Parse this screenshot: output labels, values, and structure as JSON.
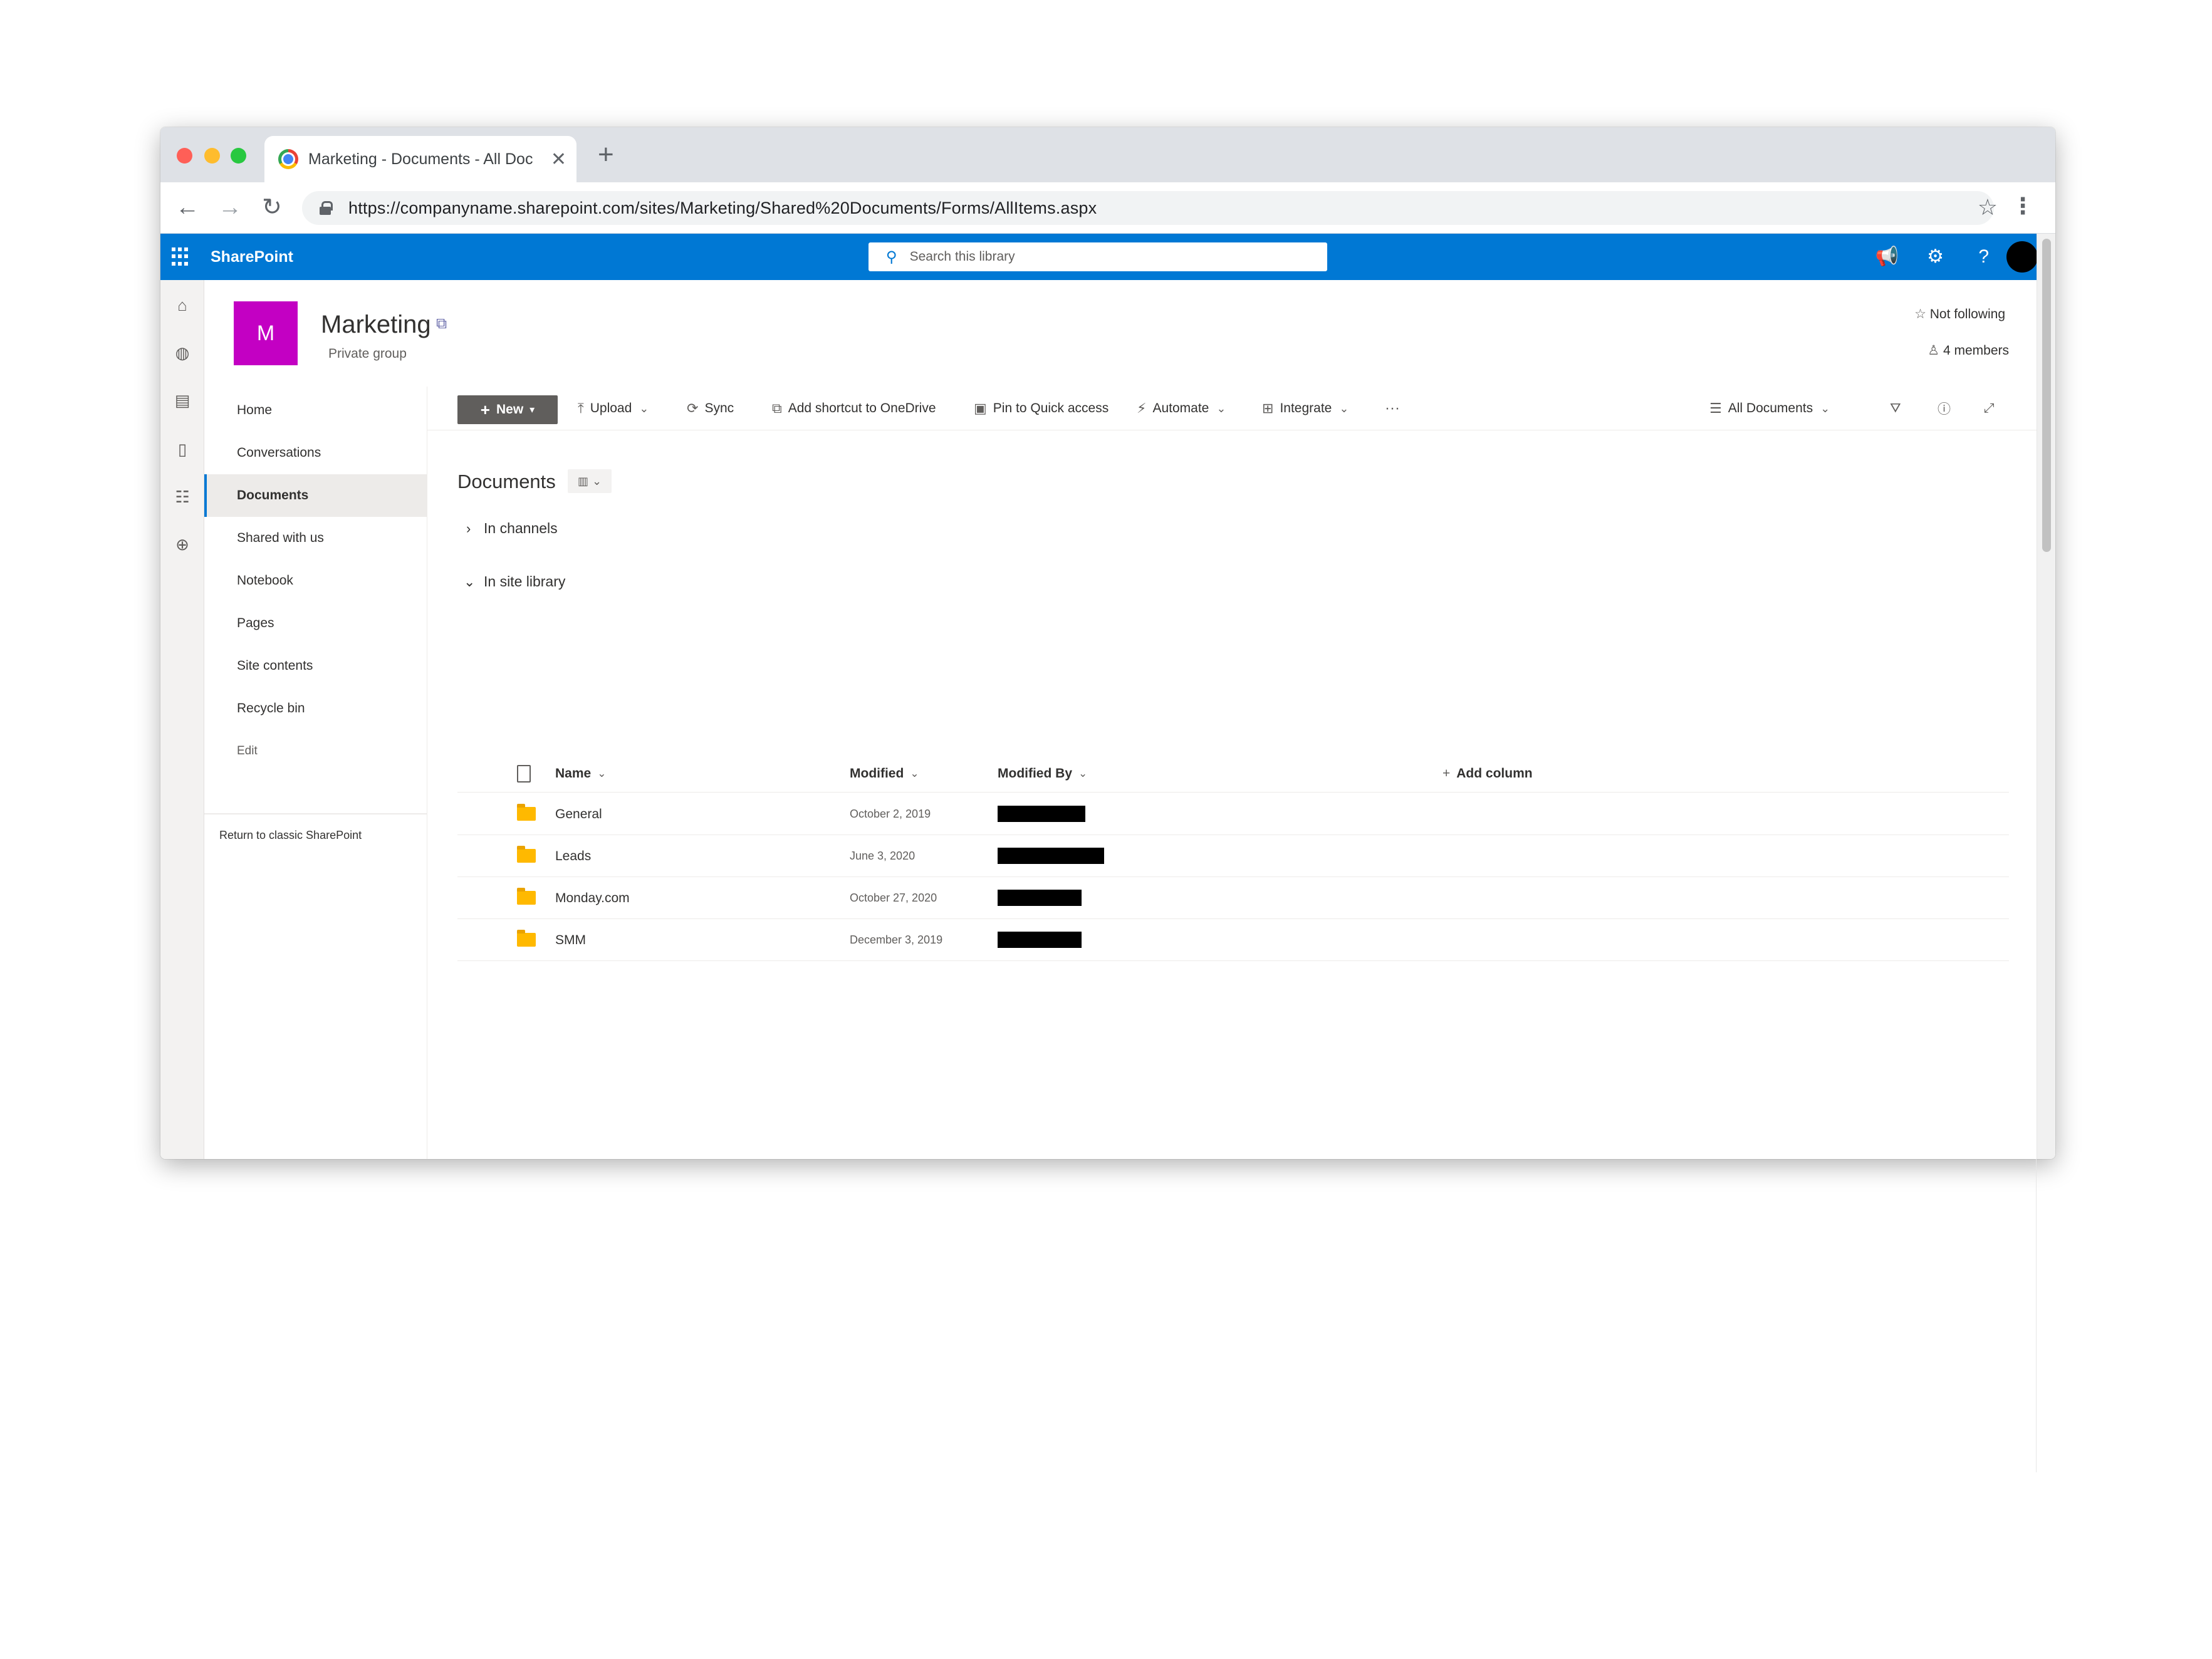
{
  "browser": {
    "tab_title": "Marketing - Documents - All Doc",
    "tab_close": "✕",
    "new_tab": "+",
    "url": "https://companyname.sharepoint.com/sites/Marketing/Shared%20Documents/Forms/AllItems.aspx",
    "icons": [
      "back-icon",
      "forward-icon",
      "reload-icon",
      "lock-icon",
      "star-icon",
      "menu-icon"
    ]
  },
  "suitebar": {
    "brand": "SharePoint",
    "search_placeholder": "Search this library",
    "accent_color": "#0078d4"
  },
  "site": {
    "logo_letter": "M",
    "logo_color": "#c300c3",
    "title": "Marketing",
    "subtitle": "Private group",
    "follow_label": "Not following",
    "members_label": "4 members"
  },
  "nav": {
    "items": [
      "Home",
      "Conversations",
      "Documents",
      "Shared with us",
      "Notebook",
      "Pages",
      "Site contents",
      "Recycle bin",
      "Edit"
    ],
    "active": "Documents",
    "return_classic": "Return to classic SharePoint"
  },
  "commands": {
    "new": "New",
    "upload": "Upload",
    "sync": "Sync",
    "add_shortcut": "Add shortcut to OneDrive",
    "pin": "Pin to Quick access",
    "automate": "Automate",
    "integrate": "Integrate",
    "more": "···",
    "view": "All Documents"
  },
  "library": {
    "title": "Documents",
    "groups": [
      {
        "label": "In channels",
        "expanded": false
      },
      {
        "label": "In site library",
        "expanded": true
      }
    ],
    "columns": {
      "name": "Name",
      "modified": "Modified",
      "modified_by": "Modified By",
      "add_column": "Add column"
    },
    "rows": [
      {
        "name": "General",
        "modified": "October 2, 2019"
      },
      {
        "name": "Leads",
        "modified": "June 3, 2020"
      },
      {
        "name": "Monday.com",
        "modified": "October 27, 2020"
      },
      {
        "name": "SMM",
        "modified": "December 3, 2019"
      }
    ]
  }
}
